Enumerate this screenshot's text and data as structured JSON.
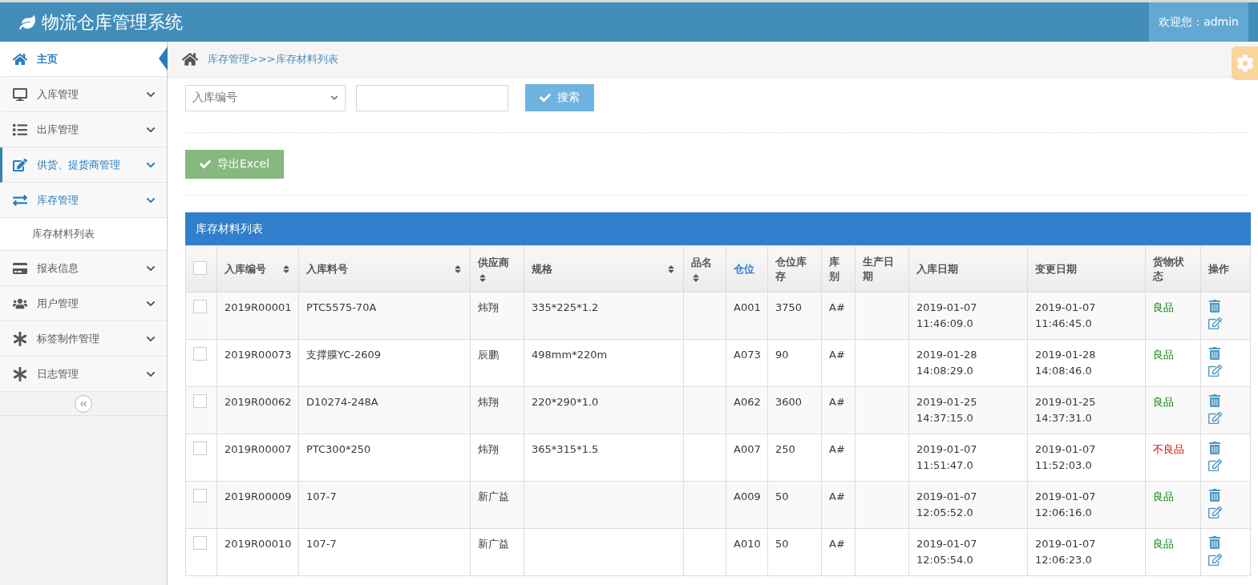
{
  "header": {
    "title": "物流仓库管理系统",
    "welcome": "欢迎您：admin"
  },
  "sidebar": {
    "items": [
      {
        "label": "主页",
        "selected": true,
        "hover": false,
        "expanded": false,
        "has_caret": false
      },
      {
        "label": "入库管理",
        "selected": false,
        "hover": false,
        "expanded": false,
        "has_caret": true
      },
      {
        "label": "出库管理",
        "selected": false,
        "hover": false,
        "expanded": false,
        "has_caret": true
      },
      {
        "label": "供货、提货商管理",
        "selected": false,
        "hover": true,
        "expanded": false,
        "has_caret": true
      },
      {
        "label": "库存管理",
        "selected": false,
        "hover": false,
        "expanded": true,
        "has_caret": true,
        "children": [
          {
            "label": "库存材料列表"
          }
        ]
      },
      {
        "label": "报表信息",
        "selected": false,
        "hover": false,
        "expanded": false,
        "has_caret": true
      },
      {
        "label": "用户管理",
        "selected": false,
        "hover": false,
        "expanded": false,
        "has_caret": true
      },
      {
        "label": "标签制作管理",
        "selected": false,
        "hover": false,
        "expanded": false,
        "has_caret": true
      },
      {
        "label": "日志管理",
        "selected": false,
        "hover": false,
        "expanded": false,
        "has_caret": true
      }
    ]
  },
  "breadcrumb": "库存管理>>>库存材料列表",
  "search": {
    "field_select": "入库编号",
    "button": "搜索"
  },
  "export_button": "导出Excel",
  "table": {
    "title": "库存材料列表",
    "select_all_checked": false,
    "columns": [
      {
        "label": "入库编号",
        "sortable": true,
        "active": false
      },
      {
        "label": "入库料号",
        "sortable": true,
        "active": false
      },
      {
        "label": "供应商",
        "sortable": true,
        "active": false
      },
      {
        "label": "规格",
        "sortable": true,
        "active": false
      },
      {
        "label": "品名",
        "sortable": true,
        "active": false
      },
      {
        "label": "仓位",
        "sortable": false,
        "active": true
      },
      {
        "label": "仓位库存",
        "sortable": false,
        "active": false
      },
      {
        "label": "库别",
        "sortable": false,
        "active": false
      },
      {
        "label": "生产日期",
        "sortable": false,
        "active": false
      },
      {
        "label": "入库日期",
        "sortable": false,
        "active": false
      },
      {
        "label": "变更日期",
        "sortable": false,
        "active": false
      },
      {
        "label": "货物状态",
        "sortable": false,
        "active": false
      },
      {
        "label": "操作",
        "sortable": false,
        "active": false
      }
    ],
    "rows": [
      {
        "checked": false,
        "cells": [
          "2019R00001",
          "PTC5575-70A",
          "炜翔",
          "335*225*1.2",
          "",
          "A001",
          "3750",
          "A#",
          "",
          "2019-01-07 11:46:09.0",
          "2019-01-07 11:46:45.0"
        ],
        "status": "良品",
        "defective": false
      },
      {
        "checked": false,
        "cells": [
          "2019R00073",
          "支撑膜YC-2609",
          "辰鹏",
          "498mm*220m",
          "",
          "A073",
          "90",
          "A#",
          "",
          "2019-01-28 14:08:29.0",
          "2019-01-28 14:08:46.0"
        ],
        "status": "良品",
        "defective": false
      },
      {
        "checked": false,
        "cells": [
          "2019R00062",
          "D10274-248A",
          "炜翔",
          "220*290*1.0",
          "",
          "A062",
          "3600",
          "A#",
          "",
          "2019-01-25 14:37:15.0",
          "2019-01-25 14:37:31.0"
        ],
        "status": "良品",
        "defective": false
      },
      {
        "checked": false,
        "cells": [
          "2019R00007",
          "PTC300*250",
          "炜翔",
          "365*315*1.5",
          "",
          "A007",
          "250",
          "A#",
          "",
          "2019-01-07 11:51:47.0",
          "2019-01-07 11:52:03.0"
        ],
        "status": "不良品",
        "defective": true
      },
      {
        "checked": false,
        "cells": [
          "2019R00009",
          "107-7",
          "新广益",
          "",
          "",
          "A009",
          "50",
          "A#",
          "",
          "2019-01-07 12:05:52.0",
          "2019-01-07 12:06:16.0"
        ],
        "status": "良品",
        "defective": false
      },
      {
        "checked": false,
        "cells": [
          "2019R00010",
          "107-7",
          "新广益",
          "",
          "",
          "A010",
          "50",
          "A#",
          "",
          "2019-01-07 12:05:54.0",
          "2019-01-07 12:06:23.0"
        ],
        "status": "良品",
        "defective": false
      }
    ]
  }
}
